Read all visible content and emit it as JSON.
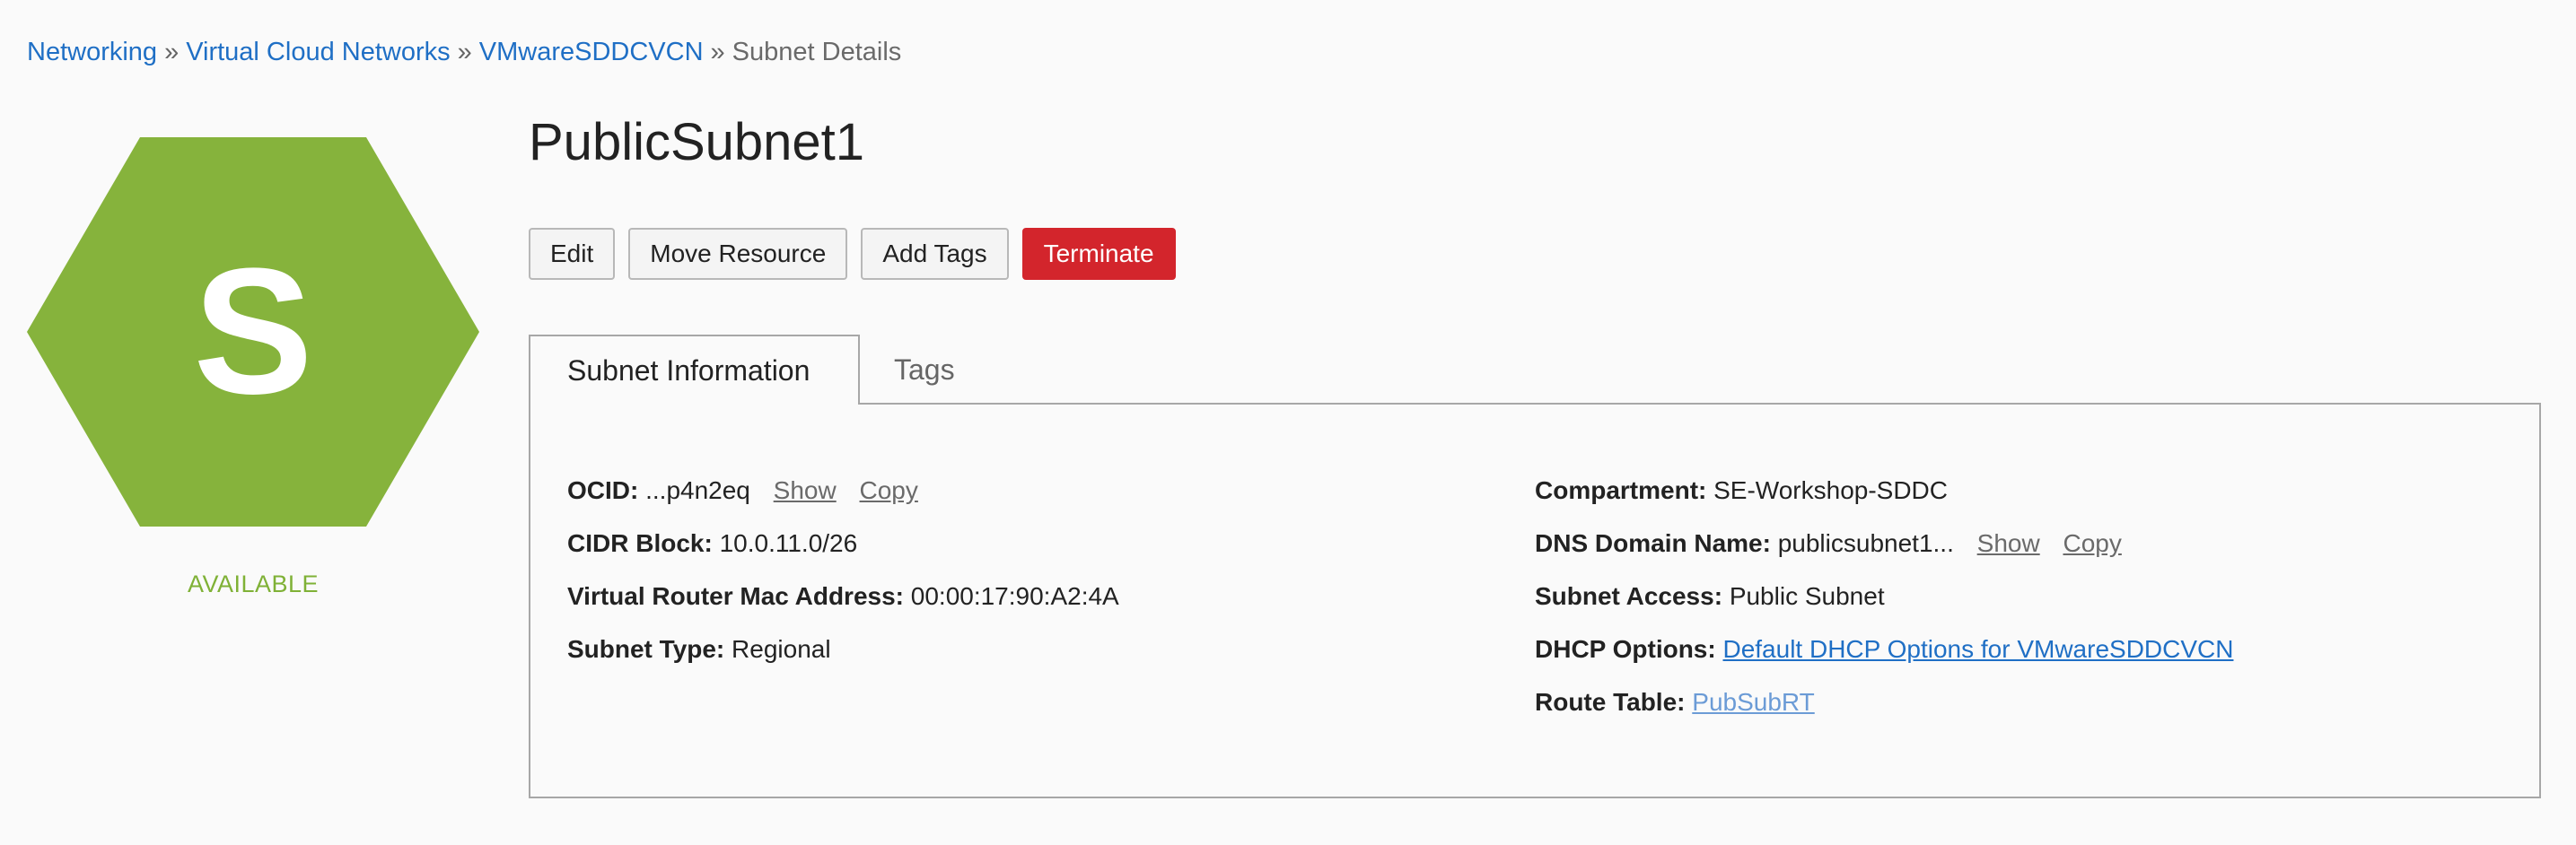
{
  "breadcrumb": {
    "items": [
      "Networking",
      "Virtual Cloud Networks",
      "VMwareSDDCVCN"
    ],
    "separator": "»",
    "current": "Subnet Details"
  },
  "resource": {
    "icon_letter": "S",
    "icon_color": "#86b33c",
    "status": "AVAILABLE",
    "status_color": "#7fb136"
  },
  "title": "PublicSubnet1",
  "actions": {
    "edit": "Edit",
    "move": "Move Resource",
    "add_tags": "Add Tags",
    "terminate": "Terminate",
    "terminate_color": "#d3252c"
  },
  "tabs": {
    "info": "Subnet Information",
    "tags": "Tags"
  },
  "details": {
    "ocid": {
      "label": "OCID:",
      "value": "...p4n2eq",
      "show": "Show",
      "copy": "Copy"
    },
    "cidr": {
      "label": "CIDR Block:",
      "value": "10.0.11.0/26"
    },
    "mac": {
      "label": "Virtual Router Mac Address:",
      "value": "00:00:17:90:A2:4A"
    },
    "subnet_type": {
      "label": "Subnet Type:",
      "value": "Regional"
    },
    "compartment": {
      "label": "Compartment:",
      "value": "SE-Workshop-SDDC"
    },
    "dns": {
      "label": "DNS Domain Name:",
      "value": "publicsubnet1...",
      "show": "Show",
      "copy": "Copy"
    },
    "access": {
      "label": "Subnet Access:",
      "value": "Public Subnet"
    },
    "dhcp": {
      "label": "DHCP Options:",
      "value": "Default DHCP Options for VMwareSDDCVCN"
    },
    "route": {
      "label": "Route Table:",
      "value": "PubSubRT"
    }
  },
  "link_color": "#1f6fc5"
}
